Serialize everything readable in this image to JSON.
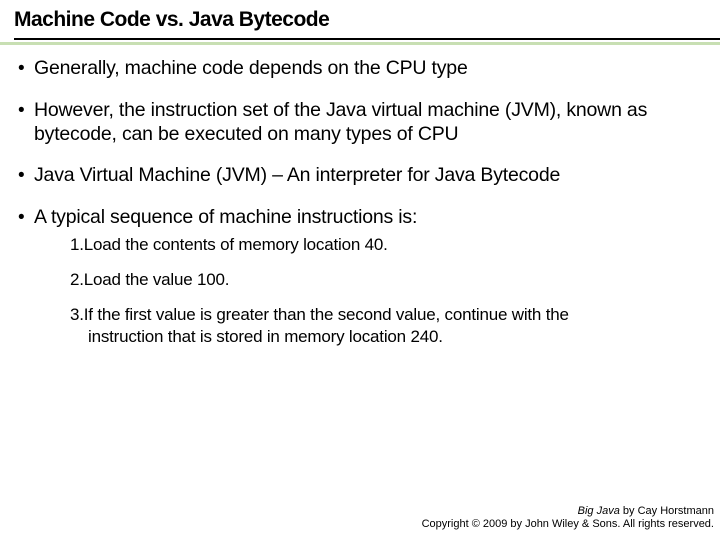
{
  "title": "Machine Code vs. Java Bytecode",
  "bullets": {
    "b1": "Generally, machine code depends on the CPU type",
    "b2": "However, the instruction set of the Java virtual machine (JVM), known as bytecode, can be executed on many types of CPU",
    "b3": "Java Virtual Machine (JVM) – An interpreter for Java Bytecode",
    "b4": "A typical sequence of machine instructions is:"
  },
  "steps": {
    "s1num": "1.",
    "s1": "Load the contents of memory location 40.",
    "s2num": "2.",
    "s2": "Load the value 100.",
    "s3num": "3.",
    "s3a": "If the first value is greater than the second value, continue with the",
    "s3b": "instruction that is stored in memory location 240."
  },
  "footer": {
    "book": "Big Java",
    "by": " by Cay Horstmann",
    "copy": "Copyright © 2009 by John Wiley & Sons.  All rights reserved."
  }
}
